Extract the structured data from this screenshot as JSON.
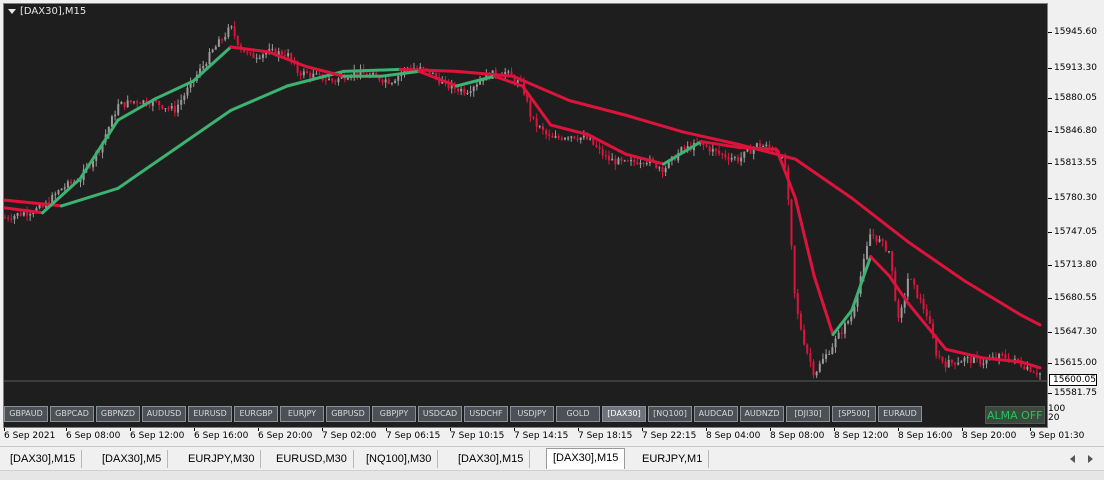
{
  "chart": {
    "title": "[DAX30],M15",
    "current_price": "15600.05"
  },
  "price_axis": [
    "15945.60",
    "15913.30",
    "15880.05",
    "15846.80",
    "15813.55",
    "15780.30",
    "15747.05",
    "15713.80",
    "15680.55",
    "15647.30",
    "15615.00",
    "15581.75"
  ],
  "indicator_scale": [
    "100",
    "20"
  ],
  "time_axis": [
    "6 Sep 2021",
    "6 Sep 08:00",
    "6 Sep 12:00",
    "6 Sep 16:00",
    "6 Sep 20:00",
    "7 Sep 02:00",
    "7 Sep 06:15",
    "7 Sep 10:15",
    "7 Sep 14:15",
    "7 Sep 18:15",
    "7 Sep 22:15",
    "8 Sep 04:00",
    "8 Sep 08:00",
    "8 Sep 12:00",
    "8 Sep 16:00",
    "8 Sep 20:00",
    "9 Sep 01:30"
  ],
  "symbol_buttons": [
    "GBPAUD",
    "GBPCAD",
    "GBPNZD",
    "AUDUSD",
    "EURUSD",
    "EURGBP",
    "EURJPY",
    "GBPUSD",
    "GBPJPY",
    "USDCAD",
    "USDCHF",
    "USDJPY",
    "GOLD",
    "[DAX30]",
    "[NQ100]",
    "AUDCAD",
    "AUDNZD",
    "[DJI30]",
    "[SP500]",
    "EURAUD"
  ],
  "active_symbol": "[DAX30]",
  "alma_button": "ALMA OFF",
  "tabs": [
    "[DAX30],M15",
    "[DAX30],M5",
    "EURJPY,M30",
    "EURUSD,M30",
    "[NQ100],M30",
    "[DAX30],M15",
    "[DAX30],M15",
    "EURJPY,M1"
  ],
  "active_tab_index": 6,
  "colors": {
    "bull_line": "#3cb371",
    "bear_line": "#dc143c",
    "candle_up": "#9a9a9a",
    "candle_down": "#dc143c",
    "background": "#1e1e1e"
  },
  "chart_data": {
    "type": "candlestick",
    "y_range": [
      15575,
      15975
    ],
    "x_labels": [
      "6 Sep 2021",
      "6 Sep 08:00",
      "6 Sep 12:00",
      "6 Sep 16:00",
      "6 Sep 20:00",
      "7 Sep 02:00",
      "7 Sep 06:15",
      "7 Sep 10:15",
      "7 Sep 14:15",
      "7 Sep 18:15",
      "7 Sep 22:15",
      "8 Sep 04:00",
      "8 Sep 08:00",
      "8 Sep 12:00",
      "8 Sep 16:00",
      "8 Sep 20:00",
      "9 Sep 01:30"
    ],
    "close_path": [
      [
        0,
        15760
      ],
      [
        2,
        15765
      ],
      [
        4,
        15770
      ],
      [
        5,
        15780
      ],
      [
        6,
        15790
      ],
      [
        8,
        15800
      ],
      [
        10,
        15830
      ],
      [
        12,
        15875
      ],
      [
        14,
        15880
      ],
      [
        16,
        15878
      ],
      [
        18,
        15870
      ],
      [
        20,
        15900
      ],
      [
        22,
        15930
      ],
      [
        24,
        15955
      ],
      [
        25,
        15935
      ],
      [
        26,
        15925
      ],
      [
        28,
        15930
      ],
      [
        30,
        15928
      ],
      [
        31,
        15910
      ],
      [
        33,
        15905
      ],
      [
        35,
        15900
      ],
      [
        37,
        15910
      ],
      [
        39,
        15905
      ],
      [
        41,
        15900
      ],
      [
        43,
        15915
      ],
      [
        45,
        15910
      ],
      [
        47,
        15895
      ],
      [
        49,
        15890
      ],
      [
        51,
        15905
      ],
      [
        53,
        15910
      ],
      [
        55,
        15895
      ],
      [
        56,
        15860
      ],
      [
        58,
        15840
      ],
      [
        60,
        15845
      ],
      [
        62,
        15840
      ],
      [
        64,
        15820
      ],
      [
        66,
        15815
      ],
      [
        68,
        15820
      ],
      [
        70,
        15810
      ],
      [
        72,
        15830
      ],
      [
        74,
        15835
      ],
      [
        76,
        15825
      ],
      [
        78,
        15820
      ],
      [
        80,
        15835
      ],
      [
        82,
        15830
      ],
      [
        83,
        15810
      ],
      [
        84,
        15670
      ],
      [
        85,
        15630
      ],
      [
        86,
        15600
      ],
      [
        88,
        15630
      ],
      [
        90,
        15660
      ],
      [
        92,
        15745
      ],
      [
        94,
        15725
      ],
      [
        95,
        15650
      ],
      [
        96,
        15700
      ],
      [
        98,
        15660
      ],
      [
        99,
        15620
      ],
      [
        100,
        15610
      ],
      [
        102,
        15615
      ],
      [
        104,
        15612
      ],
      [
        106,
        15618
      ],
      [
        108,
        15610
      ],
      [
        110,
        15600
      ]
    ],
    "alma_fast": [
      [
        0,
        15770
      ],
      [
        4,
        15765
      ],
      [
        8,
        15800
      ],
      [
        12,
        15860
      ],
      [
        16,
        15882
      ],
      [
        20,
        15900
      ],
      [
        24,
        15935
      ],
      [
        28,
        15930
      ],
      [
        32,
        15915
      ],
      [
        36,
        15905
      ],
      [
        40,
        15905
      ],
      [
        44,
        15910
      ],
      [
        48,
        15895
      ],
      [
        52,
        15905
      ],
      [
        55,
        15895
      ],
      [
        58,
        15855
      ],
      [
        62,
        15845
      ],
      [
        66,
        15825
      ],
      [
        70,
        15815
      ],
      [
        74,
        15838
      ],
      [
        78,
        15832
      ],
      [
        82,
        15830
      ],
      [
        84,
        15780
      ],
      [
        86,
        15700
      ],
      [
        88,
        15640
      ],
      [
        90,
        15665
      ],
      [
        92,
        15720
      ],
      [
        94,
        15700
      ],
      [
        96,
        15672
      ],
      [
        100,
        15625
      ],
      [
        104,
        15616
      ],
      [
        108,
        15612
      ],
      [
        110,
        15606
      ]
    ],
    "alma_slow": [
      [
        0,
        15778
      ],
      [
        6,
        15772
      ],
      [
        12,
        15790
      ],
      [
        18,
        15830
      ],
      [
        24,
        15870
      ],
      [
        30,
        15895
      ],
      [
        36,
        15910
      ],
      [
        42,
        15912
      ],
      [
        48,
        15910
      ],
      [
        54,
        15905
      ],
      [
        60,
        15880
      ],
      [
        66,
        15865
      ],
      [
        72,
        15848
      ],
      [
        78,
        15835
      ],
      [
        84,
        15820
      ],
      [
        90,
        15780
      ],
      [
        96,
        15735
      ],
      [
        102,
        15695
      ],
      [
        108,
        15660
      ],
      [
        110,
        15650
      ]
    ]
  }
}
